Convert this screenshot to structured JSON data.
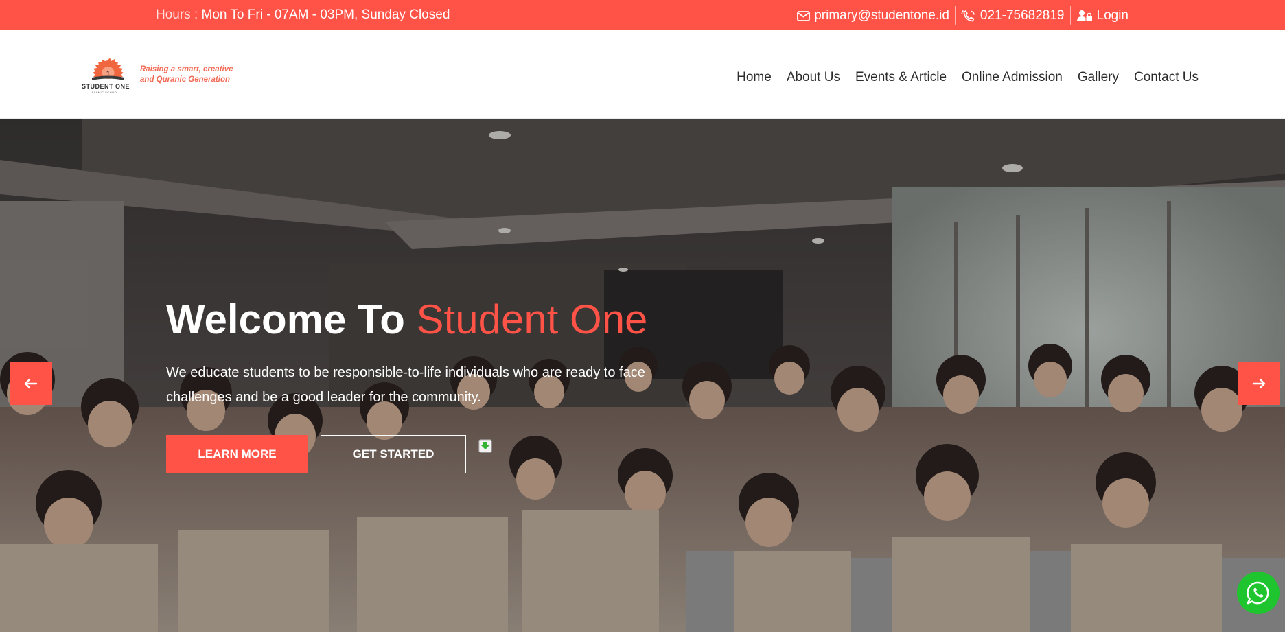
{
  "topbar": {
    "hours_label": "Hours :",
    "hours_value": "Mon To Fri - 07AM - 03PM, Sunday Closed",
    "email": "primary@studentone.id",
    "phone": "021-75682819",
    "login": "Login",
    "icons": [
      "envelope-icon",
      "phone-icon",
      "user-lock-icon"
    ]
  },
  "logo": {
    "name": "STUDENT ONE",
    "sub": "ISLAMIC SCHOOL",
    "tagline_line1": "Raising a smart, creative",
    "tagline_line2": "and Quranic Generation"
  },
  "nav": {
    "items": [
      "Home",
      "About Us",
      "Events & Article",
      "Online Admission",
      "Gallery",
      "Contact Us"
    ]
  },
  "hero": {
    "title_main": "Welcome To ",
    "title_accent": "Student One",
    "description": "We educate students to be responsible-to-life individuals who are ready to face challenges and be a good leader for the community.",
    "learn_more": "LEARN MORE",
    "get_started": "GET STARTED"
  },
  "colors": {
    "accent": "#ff5348",
    "whatsapp": "#1ec52f",
    "text_dark": "#2c2c2c"
  }
}
